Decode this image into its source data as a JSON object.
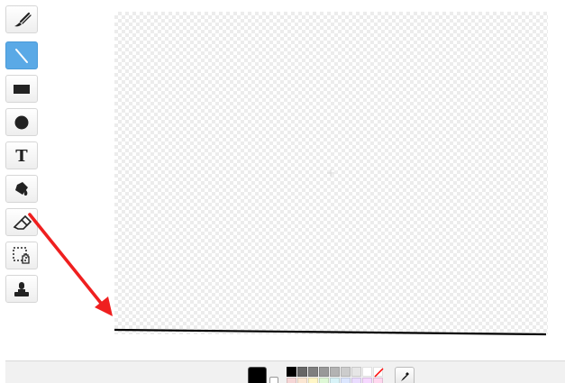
{
  "editor": {
    "tools": [
      {
        "name": "brush",
        "icon": "brush-icon",
        "selected": false
      },
      {
        "name": "line",
        "icon": "line-icon",
        "selected": true
      },
      {
        "name": "rectangle",
        "icon": "rectangle-icon",
        "selected": false
      },
      {
        "name": "ellipse",
        "icon": "ellipse-icon",
        "selected": false
      },
      {
        "name": "text",
        "icon": "text-icon",
        "selected": false,
        "label": "T"
      },
      {
        "name": "fill",
        "icon": "bucket-icon",
        "selected": false
      },
      {
        "name": "eraser",
        "icon": "eraser-icon",
        "selected": false
      },
      {
        "name": "select",
        "icon": "select-hand-icon",
        "selected": false
      },
      {
        "name": "stamp",
        "icon": "stamp-icon",
        "selected": false
      }
    ],
    "colors": {
      "accent": "#5aa9e6",
      "arrow": "#ef1f1f",
      "current": "#000000",
      "line": "#000000"
    },
    "palette": [
      "#000000",
      "#666666",
      "#7f7f7f",
      "#999999",
      "#b3b3b3",
      "#cccccc",
      "#e6e6e6",
      "#ffffff",
      "#ff0000",
      "#f5d6d6",
      "#fbe6d2",
      "#fff6c6",
      "#def8d6",
      "#d8f3f8",
      "#dce6ff",
      "#eadcff",
      "#f6d8ff",
      "#ffd8ef"
    ]
  }
}
